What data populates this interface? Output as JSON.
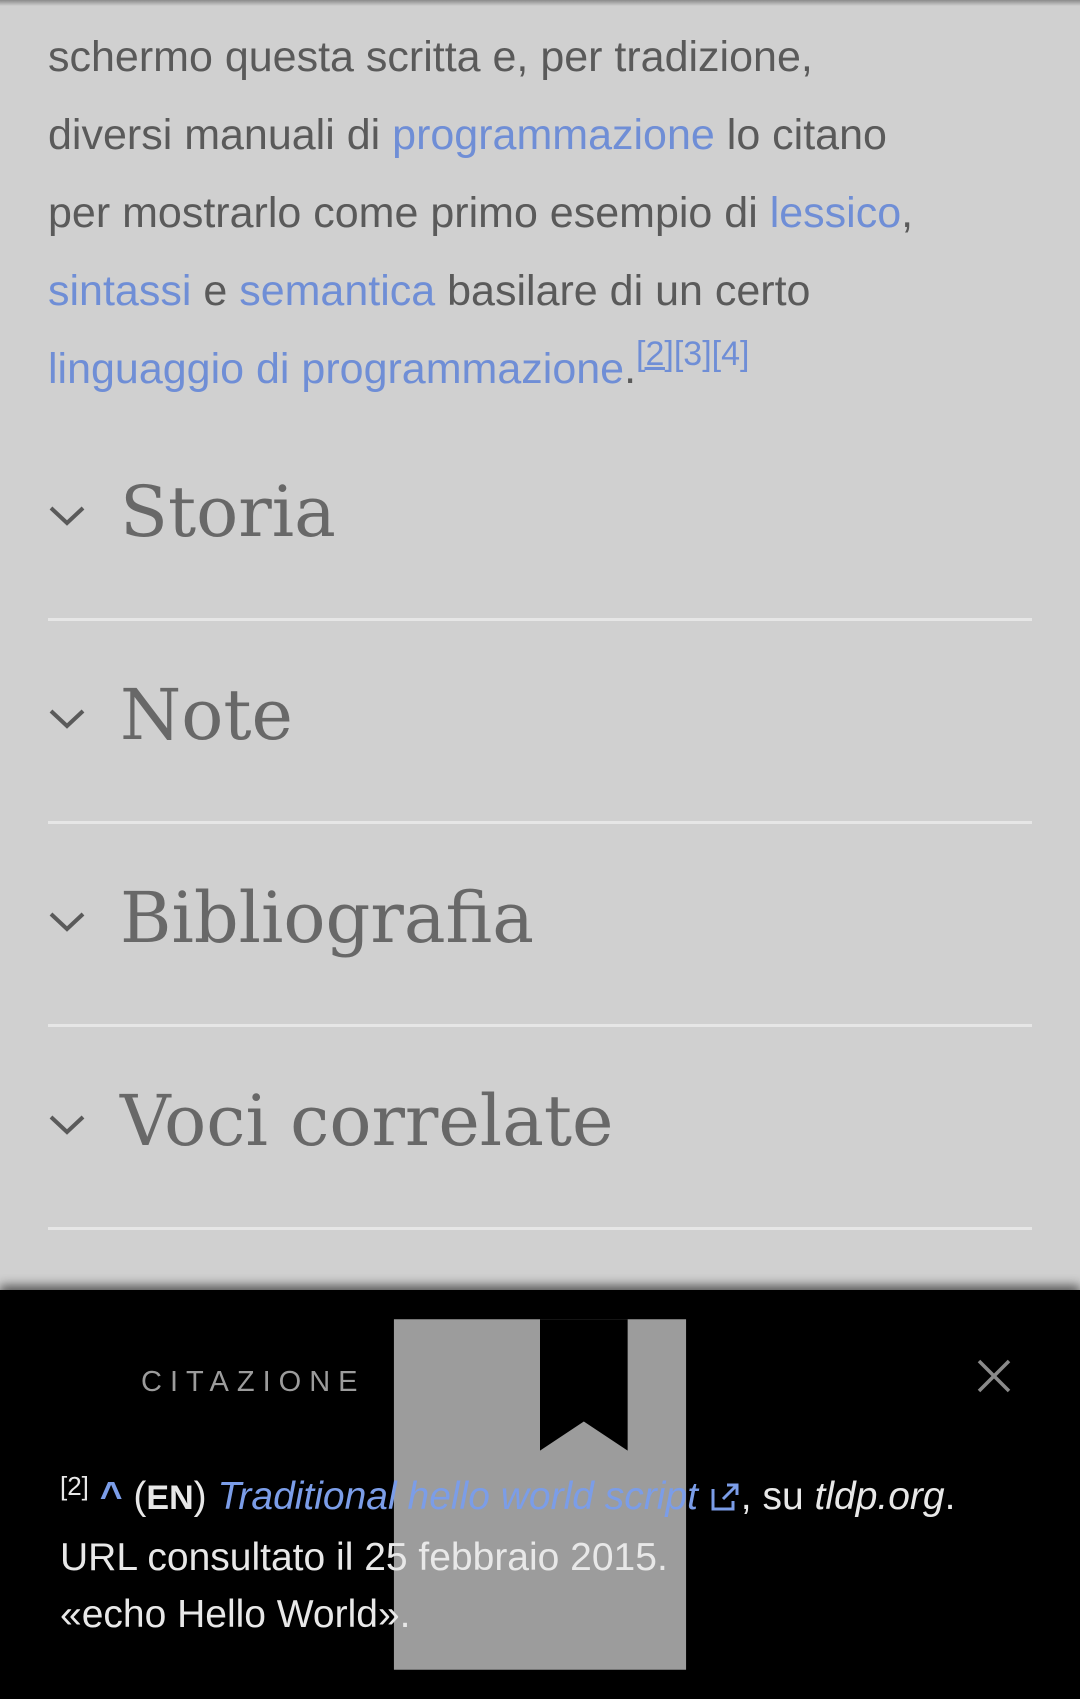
{
  "article": {
    "line1": "schermo questa scritta e, per tradizione,",
    "line2_pre": "diversi manuali di ",
    "link_programmazione": "programmazione",
    "line2_post": " lo citano",
    "line3_pre": "per mostrarlo come primo esempio di ",
    "link_lessico": "lessico",
    "comma": ",",
    "link_sintassi": "sintassi",
    "e": " e ",
    "link_semantica": "semantica",
    "line4_post": " basilare di un certo",
    "link_linguaggio": "linguaggio di programmazione",
    "period": ".",
    "ref2": "[2]",
    "ref3": "[3]",
    "ref4": "[4]"
  },
  "sections": [
    {
      "title": "Storia"
    },
    {
      "title": "Note"
    },
    {
      "title": "Bibliografia"
    },
    {
      "title": "Voci correlate"
    }
  ],
  "drawer": {
    "label": "CITAZIONE",
    "icon": "book-icon",
    "close_icon": "close-icon",
    "citation": {
      "number": "[2]",
      "caret": "^",
      "lang_open": "(",
      "lang": "EN",
      "lang_close": ")",
      "title": "Traditional hello world script",
      "su": ", su ",
      "site": "tldp.org",
      "dot": ".",
      "accessed": "URL consultato il 25 febbraio 2015.",
      "quote": "«echo Hello World»."
    }
  },
  "colors": {
    "background": "#d0d0d0",
    "link": "#6f8ed6",
    "drawer": "#000000"
  }
}
